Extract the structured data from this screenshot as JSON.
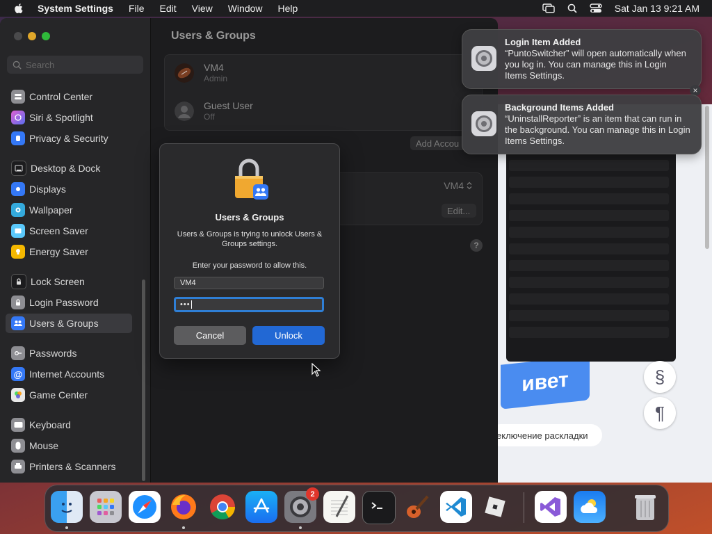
{
  "menubar": {
    "app_name": "System Settings",
    "menus": [
      "File",
      "Edit",
      "View",
      "Window",
      "Help"
    ],
    "clock": "Sat Jan 13  9:21 AM",
    "icons": [
      "screen-mirroring-icon",
      "spotlight-search-icon",
      "control-center-icon"
    ]
  },
  "sidebar": {
    "search_placeholder": "Search",
    "items": [
      {
        "label": "Control Center",
        "icon": "control-center-icon",
        "color": "#8e8e93"
      },
      {
        "label": "Siri & Spotlight",
        "icon": "siri-icon",
        "color": "#c45fd0"
      },
      {
        "label": "Privacy & Security",
        "icon": "hand-icon",
        "color": "#3478f6"
      },
      {
        "label": "Desktop & Dock",
        "icon": "dock-icon",
        "color": "#1c1c1e"
      },
      {
        "label": "Displays",
        "icon": "sun-icon",
        "color": "#3478f6"
      },
      {
        "label": "Wallpaper",
        "icon": "flower-icon",
        "color": "#34aadc"
      },
      {
        "label": "Screen Saver",
        "icon": "screen-saver-icon",
        "color": "#5ac8fa"
      },
      {
        "label": "Energy Saver",
        "icon": "bulb-icon",
        "color": "#f5b800"
      },
      {
        "label": "Lock Screen",
        "icon": "lock-icon",
        "color": "#1c1c1e"
      },
      {
        "label": "Login Password",
        "icon": "lock-icon",
        "color": "#8e8e93"
      },
      {
        "label": "Users & Groups",
        "icon": "users-icon",
        "color": "#3478f6"
      },
      {
        "label": "Passwords",
        "icon": "key-icon",
        "color": "#8e8e93"
      },
      {
        "label": "Internet Accounts",
        "icon": "at-icon",
        "color": "#3478f6"
      },
      {
        "label": "Game Center",
        "icon": "game-center-icon",
        "color": "#e8e8e8"
      },
      {
        "label": "Keyboard",
        "icon": "keyboard-icon",
        "color": "#8e8e93"
      },
      {
        "label": "Mouse",
        "icon": "mouse-icon",
        "color": "#8e8e93"
      },
      {
        "label": "Printers & Scanners",
        "icon": "printer-icon",
        "color": "#8e8e93"
      }
    ],
    "active_label": "Users & Groups"
  },
  "main": {
    "title": "Users & Groups",
    "users": [
      {
        "name": "VM4",
        "role": "Admin",
        "icon": "football-avatar-icon"
      },
      {
        "name": "Guest User",
        "role": "Off",
        "icon": "person-avatar-icon"
      }
    ],
    "add_account_label": "Add Accou",
    "login_user_value": "VM4",
    "edit_label": "Edit...",
    "help_label": "?"
  },
  "dialog": {
    "title": "Users & Groups",
    "message": "Users & Groups is trying to unlock Users & Groups settings.",
    "prompt": "Enter your password to allow this.",
    "username_value": "VM4",
    "password_value": "•••",
    "cancel_label": "Cancel",
    "unlock_label": "Unlock",
    "icon": "padlock-users-icon"
  },
  "notifications": [
    {
      "title": "Login Item Added",
      "body": "“PuntoSwitcher” will open automatically when you log in. You can manage this in Login Items Settings.",
      "icon": "settings-gear-icon"
    },
    {
      "title": "Background Items Added",
      "body": "“UninstallReporter” is an item that can run in the background. You can manage this in Login Items Settings.",
      "icon": "settings-gear-icon"
    }
  ],
  "close_glyph": "×",
  "punto": {
    "banner_text": "ивет",
    "section_glyph": "§",
    "pilcrow_glyph": "¶",
    "caption": "еключение раскладки"
  },
  "dock": {
    "apps": [
      {
        "name": "Finder",
        "icon": "finder-icon",
        "running": true
      },
      {
        "name": "Launchpad",
        "icon": "launchpad-icon",
        "running": false
      },
      {
        "name": "Safari",
        "icon": "safari-icon",
        "running": false
      },
      {
        "name": "Firefox",
        "icon": "firefox-icon",
        "running": true
      },
      {
        "name": "Chrome",
        "icon": "chrome-icon",
        "running": false
      },
      {
        "name": "App Store",
        "icon": "app-store-icon",
        "running": false
      },
      {
        "name": "System Settings",
        "icon": "system-settings-icon",
        "running": true
      },
      {
        "name": "TextEdit",
        "icon": "textedit-icon",
        "running": false
      },
      {
        "name": "Terminal",
        "icon": "terminal-icon",
        "running": false
      },
      {
        "name": "GarageBand",
        "icon": "guitar-icon",
        "running": false
      },
      {
        "name": "Visual Studio Code",
        "icon": "vscode-icon",
        "running": false
      },
      {
        "name": "Roblox",
        "icon": "roblox-icon",
        "running": false
      },
      {
        "name": "Visual Studio",
        "icon": "visual-studio-icon",
        "running": false
      },
      {
        "name": "Weather",
        "icon": "weather-icon",
        "running": false
      },
      {
        "name": "Trash",
        "icon": "trash-icon",
        "running": false
      }
    ],
    "settings_badge": "2"
  }
}
